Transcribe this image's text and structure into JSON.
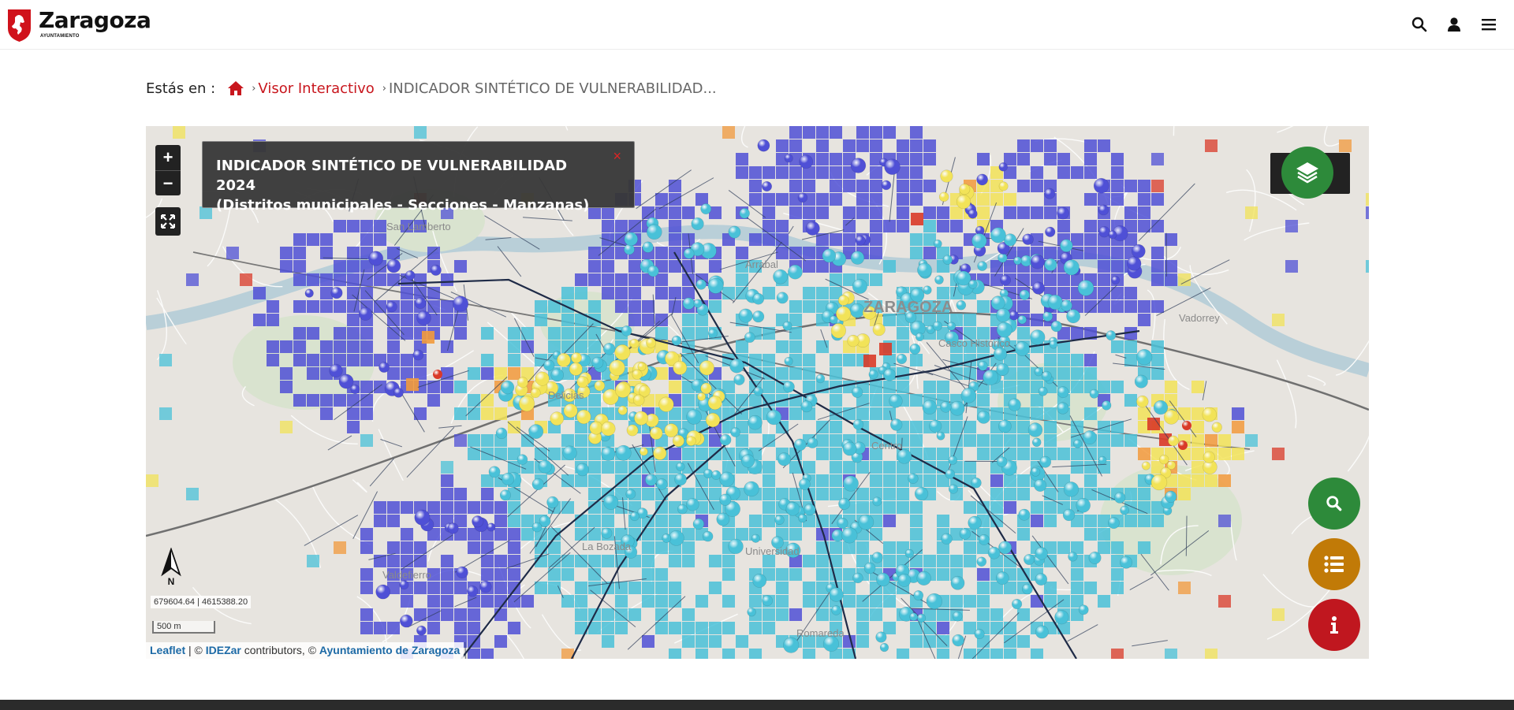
{
  "header": {
    "logo_name": "Zaragoza",
    "logo_sub": "AYUNTAMIENTO",
    "icons": [
      "search-icon",
      "user-icon",
      "menu-icon"
    ]
  },
  "breadcrumb": {
    "prefix": "Estás en :",
    "home_icon": "home-icon",
    "items": [
      "Visor Interactivo",
      "INDICADOR SINTÉTICO DE VULNERABILIDAD..."
    ]
  },
  "map": {
    "title_line1": "INDICADOR SINTÉTICO DE VULNERABILIDAD 2024",
    "title_line2": "(Distritos municipales - Secciones - Manzanas)",
    "close": "×",
    "zoom_in": "+",
    "zoom_out": "−",
    "north_label": "N",
    "coordinates": "679604.64 | 4615388.20",
    "scale": "500 m",
    "place_labels": [
      "San Lamberto",
      "ZARAGOZA",
      "Vadorrey",
      "Arrabal",
      "Delicias",
      "Universidad",
      "La Bozada",
      "Valdefierro",
      "Casco Histórico",
      "Centro",
      "Romareda"
    ],
    "attribution": {
      "leaflet": "Leaflet",
      "sep1": " | © ",
      "idezar": "IDEZar",
      "sep2": " contributors, © ",
      "ayto": "Ayuntamiento de Zaragoza"
    },
    "legend_colors": {
      "very_low": "#4f50d6",
      "low": "#49c1d8",
      "medium": "#f2e358",
      "high": "#f29a3c",
      "very_high": "#d93a28"
    }
  },
  "buttons": {
    "layers": "layers-icon",
    "search": "search-icon",
    "list": "list-icon",
    "info": "info-icon"
  },
  "colors": {
    "brand_red": "#c8161d",
    "search_green": "#2d8a3a",
    "list_gold": "#c17a07",
    "info_red": "#c0171f"
  }
}
